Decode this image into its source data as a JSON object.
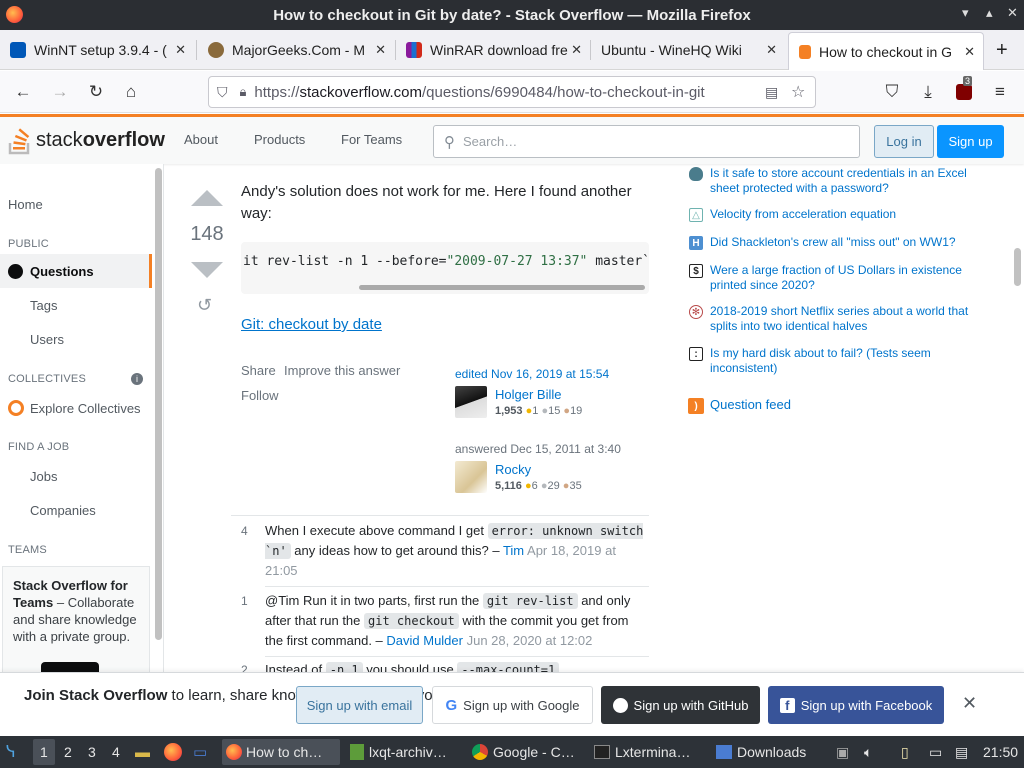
{
  "window": {
    "title": "How to checkout in Git by date? - Stack Overflow — Mozilla Firefox"
  },
  "tabs": [
    {
      "label": "WinNT setup 3.9.4 - (",
      "color": "#0057b7"
    },
    {
      "label": "MajorGeeks.Com - M",
      "color": "#6b4e2e"
    },
    {
      "label": "WinRAR download fre",
      "color": "#8a1a9c"
    },
    {
      "label": "Ubuntu - WineHQ Wiki",
      "color": "#ffffff"
    },
    {
      "label": "How to checkout in G",
      "color": "#f48024"
    }
  ],
  "nav": {
    "url_prefix": "https://",
    "url_host": "stackoverflow.com",
    "url_path": "/questions/6990484/how-to-checkout-in-git",
    "extension_badge": "3"
  },
  "so_header": {
    "logo_light": "stack",
    "logo_bold": "overflow",
    "links": [
      "About",
      "Products",
      "For Teams"
    ],
    "search_placeholder": "Search…",
    "login": "Log in",
    "signup": "Sign up"
  },
  "left_nav": {
    "home": "Home",
    "public": "PUBLIC",
    "questions": "Questions",
    "tags": "Tags",
    "users": "Users",
    "collectives": "COLLECTIVES",
    "explore": "Explore Collectives",
    "find_job": "FIND A JOB",
    "jobs": "Jobs",
    "companies": "Companies",
    "teams": "TEAMS",
    "teams_title": "Stack Overflow for Teams",
    "teams_desc": " – Collaborate and share knowledge with a private group."
  },
  "answer": {
    "score": "148",
    "text": "Andy's solution does not work for me. Here I found another way:",
    "code_prefix": "it rev-list -n 1 --before=",
    "code_string": "\"2009-07-27 13:37\"",
    "code_suffix": " master`",
    "link": "Git: checkout by date",
    "share": "Share",
    "improve": "Improve this answer",
    "follow": "Follow",
    "edited": "edited Nov 16, 2019 at 15:54",
    "editor": {
      "name": "Holger Bille",
      "rep": "1,953",
      "gold": "1",
      "silver": "15",
      "bronze": "19"
    },
    "answered": "answered Dec 15, 2011 at 3:40",
    "author": {
      "name": "Rocky",
      "rep": "5,116",
      "gold": "6",
      "silver": "29",
      "bronze": "35"
    }
  },
  "comments": [
    {
      "votes": "4",
      "t1": "When I execute above command I get ",
      "c1": "error: unknown switch `n'",
      "t2": " any ideas how to get around this? – ",
      "user": "Tim",
      "time": "Apr 18, 2019 at 21:05"
    },
    {
      "votes": "1",
      "t1": "@Tim Run it in two parts, first run the ",
      "c1": "git rev-list",
      "t2": " and only after that run the ",
      "c2": "git checkout",
      "t3": " with the commit you get from the first command. – ",
      "user": "David Mulder",
      "time": "Jun 28, 2020 at 12:02"
    },
    {
      "votes": "2",
      "t1": "Instead of ",
      "c1": "-n 1",
      "t2": " you should use ",
      "c2": "--max-count=1"
    }
  ],
  "hot_questions": [
    {
      "text": "Is it safe to store account credentials in an Excel sheet protected with a password?",
      "icon_color": "#4a7c8c"
    },
    {
      "text": "Velocity from acceleration equation",
      "icon_color": "#6fb3b0"
    },
    {
      "text": "Did Shackleton's crew all \"miss out\" on WW1?",
      "icon_color": "#4d8fd1"
    },
    {
      "text": "Were a large fraction of US Dollars in existence printed since 2020?",
      "icon_color": "#222222"
    },
    {
      "text": "2018-2019 short Netflix series about a world that splits into two identical halves",
      "icon_color": "#b84a4a"
    },
    {
      "text": "Is my hard disk about to fail? (Tests seem inconsistent)",
      "icon_color": "#222222"
    }
  ],
  "question_feed": "Question feed",
  "banner": {
    "bold": "Join Stack Overflow",
    "rest": " to learn, share knowledge, and build your career.",
    "email": "Sign up with email",
    "google": "Sign up with Google",
    "github": "Sign up with GitHub",
    "facebook": "Sign up with Facebook"
  },
  "taskbar": {
    "workspaces": [
      "1",
      "2",
      "3",
      "4"
    ],
    "tasks": [
      "How to ch…",
      "lxqt-archiv…",
      "Google - C…",
      "Lxtermina…",
      "Downloads"
    ],
    "clock": "21:50"
  }
}
